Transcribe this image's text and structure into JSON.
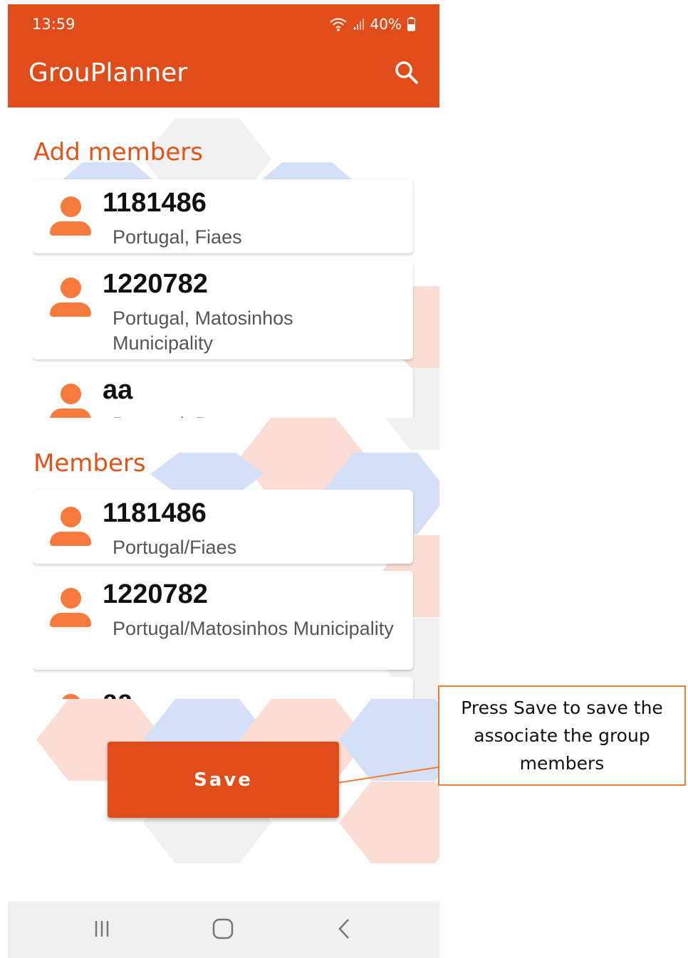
{
  "status_bar": {
    "time": "13:59",
    "battery": "40%"
  },
  "app_bar": {
    "title": "GrouPlanner",
    "search_icon": "search-icon"
  },
  "add_members": {
    "title": "Add members",
    "items": [
      {
        "name": "1181486",
        "location": "Portugal, Fiaes"
      },
      {
        "name": "1220782",
        "location": "Portugal, Matosinhos Municipality"
      },
      {
        "name": "aa",
        "location": "Portugal, Porto"
      }
    ]
  },
  "members": {
    "title": "Members",
    "items": [
      {
        "name": "1181486",
        "location": "Portugal/Fiaes"
      },
      {
        "name": "1220782",
        "location": "Portugal/Matosinhos Municipality"
      },
      {
        "name": "aa",
        "location": ""
      }
    ]
  },
  "save_label": "Save",
  "nav": {
    "recents_icon": "recents-icon",
    "home_icon": "home-icon",
    "back_icon": "back-icon"
  },
  "annotation": {
    "text": "Press Save to save the associate the group members"
  },
  "colors": {
    "primary": "#E04D1A",
    "accent": "#E05418",
    "avatar": "#F57A3C",
    "callout_border": "#ED7D31"
  }
}
